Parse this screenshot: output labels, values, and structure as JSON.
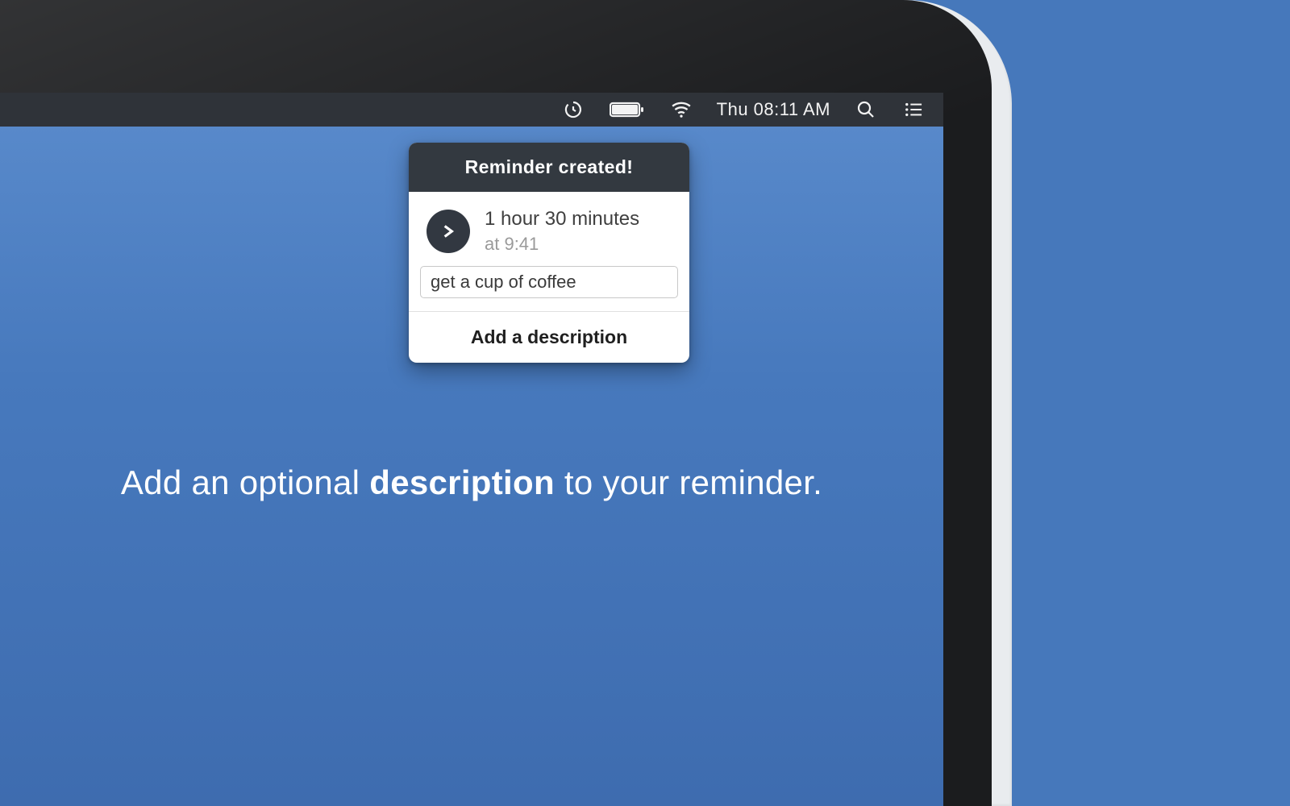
{
  "menubar": {
    "clock_text": "Thu 08:11 AM",
    "icons": {
      "app": "gestimer-icon",
      "battery": "battery-icon",
      "wifi": "wifi-icon",
      "spotlight": "search-icon",
      "notifications": "list-icon"
    }
  },
  "popover": {
    "title": "Reminder created!",
    "duration": "1 hour 30 minutes",
    "at_time": "at 9:41",
    "description_value": "get a cup of coffee",
    "footer": "Add a description"
  },
  "caption": {
    "pre": "Add an optional ",
    "bold": "description",
    "post": " to your reminder."
  }
}
